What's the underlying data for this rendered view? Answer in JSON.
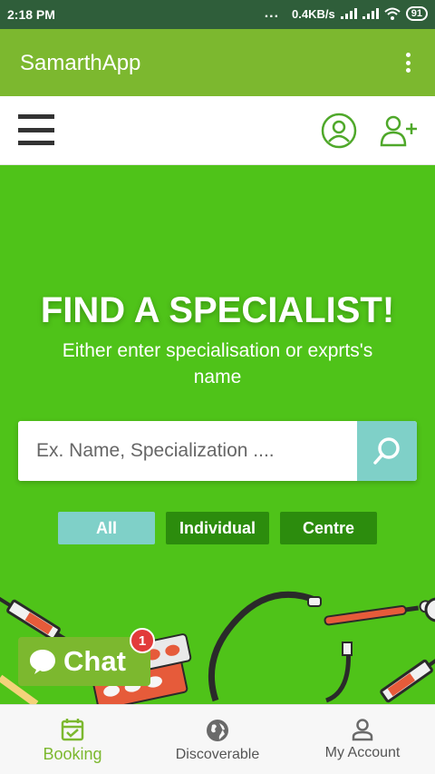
{
  "status_bar": {
    "time": "2:18 PM",
    "dots": "...",
    "network_speed": "0.4KB/s",
    "battery": "91"
  },
  "app_bar": {
    "title": "SamarthApp"
  },
  "hero": {
    "title": "FIND A SPECIALIST!",
    "subtitle": "Either enter specialisation or exprts's name",
    "search": {
      "placeholder": "Ex. Name, Specialization ....",
      "value": ""
    },
    "filters": [
      {
        "label": "All",
        "selected": true
      },
      {
        "label": "Individual",
        "selected": false
      },
      {
        "label": "Centre",
        "selected": false
      }
    ]
  },
  "chat": {
    "label": "Chat",
    "badge_count": "1"
  },
  "bottom_nav": [
    {
      "label": "Booking",
      "icon": "calendar-check-icon",
      "active": true
    },
    {
      "label": "Discoverable",
      "icon": "globe-icon",
      "active": false
    },
    {
      "label": "My Account",
      "icon": "person-icon",
      "active": false
    }
  ],
  "colors": {
    "status_bar": "#2f5e3a",
    "app_bar": "#7cb82f",
    "hero": "#4fc319",
    "accent_teal": "#7fd0c8",
    "filter_dark": "#2c8c0d",
    "badge": "#e23b3b"
  }
}
